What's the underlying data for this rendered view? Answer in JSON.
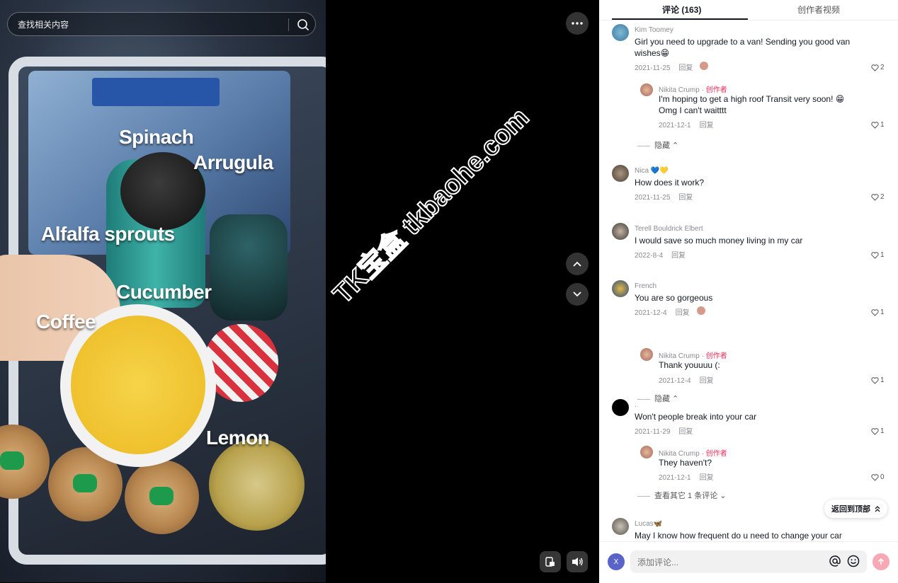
{
  "search": {
    "placeholder": "查找相关内容"
  },
  "video": {
    "captions": {
      "spinach": "Spinach",
      "arrugula": "Arrugula",
      "alfalfa": "Alfalfa sprouts",
      "cucumber": "Cucumber",
      "coffee": "Coffee",
      "lemon": "Lemon"
    },
    "watermark": "TK宝盒 tkbaohe.com"
  },
  "tabs": {
    "comments": "评论 (163)",
    "creator_videos": "创作者视频"
  },
  "comments": [
    {
      "name": "Kim Toomey",
      "text": "Girl you need to upgrade to a van! Sending you good van wishes😁",
      "date": "2021-11-25",
      "reply": "回复",
      "likes": "2",
      "replies": [
        {
          "name": "Nikita Crump",
          "creator_tag": "· 创作者",
          "text": "I'm hoping to get a high roof Transit very soon! 😁 Omg I can't waitttt",
          "date": "2021-12-1",
          "reply": "回复",
          "likes": "1"
        }
      ],
      "toggle": "隐藏 ⌃"
    },
    {
      "name": "Nica 💙💛",
      "text": "How does it work?",
      "date": "2021-11-25",
      "reply": "回复",
      "likes": "2"
    },
    {
      "name": "Terell Bouldrick Elbert",
      "text": "I would save so much money living in my car",
      "date": "2022-8-4",
      "reply": "回复",
      "likes": "1"
    },
    {
      "name": "French",
      "text": "You are so gorgeous",
      "date": "2021-12-4",
      "reply": "回复",
      "likes": "1",
      "replies": [
        {
          "name": "Nikita Crump",
          "creator_tag": "· 创作者",
          "text": "Thank youuuu (:",
          "date": "2021-12-4",
          "reply": "回复",
          "likes": "1"
        }
      ],
      "toggle": "隐藏 ⌃"
    },
    {
      "name": ".",
      "text": "Won't people break into your car",
      "date": "2021-11-29",
      "reply": "回复",
      "likes": "1",
      "replies": [
        {
          "name": "Nikita Crump",
          "creator_tag": "· 创作者",
          "text": "They haven't?",
          "date": "2021-12-1",
          "reply": "回复",
          "likes": "0"
        }
      ],
      "toggle": "查看其它 1 条评论 ⌄"
    },
    {
      "name": "Lucas🦋",
      "text": "May I know how frequent do u need to change your car"
    }
  ],
  "back_to_top": "返回到顶部",
  "comment_input": {
    "placeholder": "添加评论...",
    "avatar_letter": "X"
  },
  "colors": {
    "creator_accent": "#fe2c55",
    "send_button": "#f7a8b4",
    "avatar_default": "#5a64c8"
  }
}
